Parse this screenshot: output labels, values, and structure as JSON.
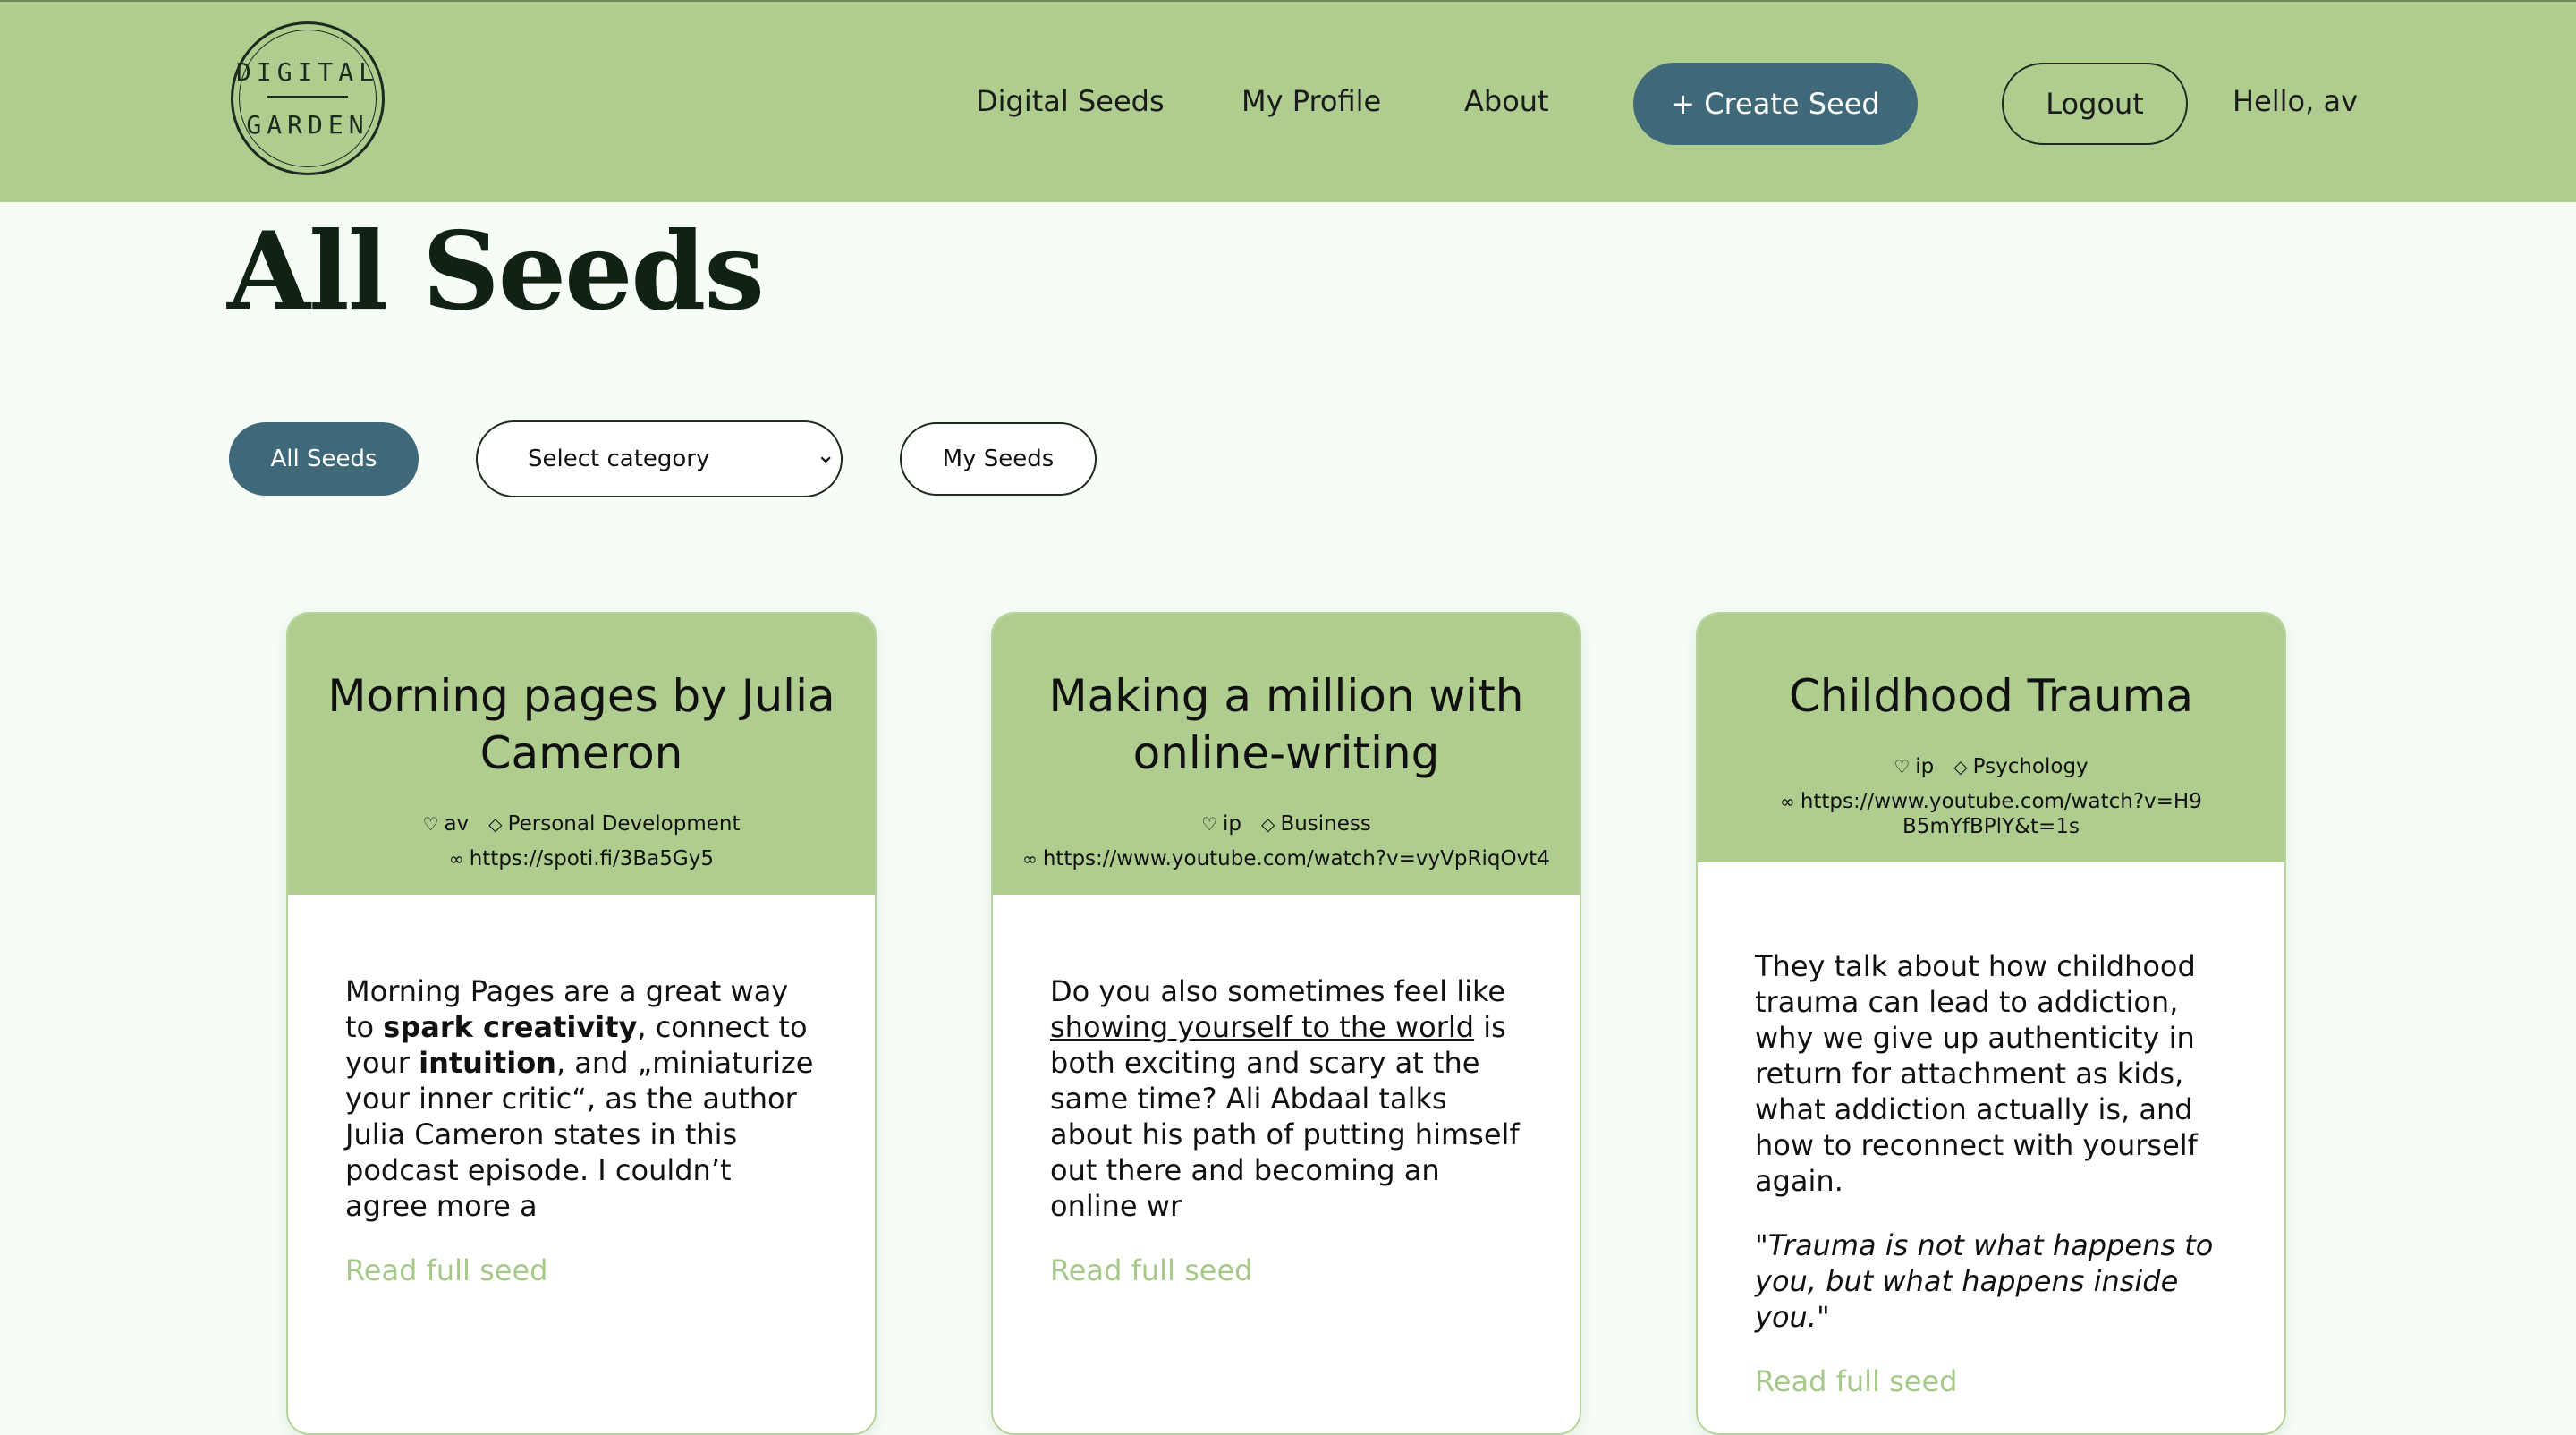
{
  "logo": {
    "line1": "DIGITAL",
    "line2": "GARDEN"
  },
  "nav": {
    "digital_seeds": "Digital Seeds",
    "my_profile": "My Profile",
    "about": "About",
    "create_seed": "+ Create Seed",
    "logout": "Logout",
    "greeting": "Hello, av"
  },
  "page_title": "All Seeds",
  "filters": {
    "all_seeds": "All Seeds",
    "category_select": "Select category",
    "my_seeds": "My Seeds"
  },
  "cards": [
    {
      "title": "Morning pages by Julia Cameron",
      "author": "av",
      "category": "Personal Development",
      "url": "https://spoti.fi/3Ba5Gy5",
      "body_parts": [
        "Morning Pages are a great way to ",
        "spark creativity",
        ", connect to your ",
        "intuition",
        ", and „miniaturize your inner critic“, as the author Julia Cameron states in this podcast episode. I couldn’t agree more a"
      ],
      "read_more": "Read full seed"
    },
    {
      "title": "Making a million with online-writing",
      "author": "ip",
      "category": "Business",
      "url": "https://www.youtube.com/watch?v=vyVpRiqOvt4",
      "body_parts": [
        "Do you also sometimes feel like ",
        "showing yourself to the world",
        " is both exciting and scary at the same time? Ali Abdaal talks about his path of putting himself out there and becoming an online wr"
      ],
      "read_more": "Read full seed"
    },
    {
      "title": "Childhood Trauma",
      "author": "ip",
      "category": "Psychology",
      "url": "https://www.youtube.com/watch?v=H9B5mYfBPlY&t=1s",
      "body_text": "They talk about how childhood trauma can lead to addiction, why we give up authenticity in return for attachment as kids, what addiction actually is, and how to reconnect with yourself again.",
      "quote": "\"Trauma is not what happens to you, but what happens inside you.\"",
      "read_more": "Read full seed"
    }
  ],
  "colors": {
    "header_bg": "#afcd8f",
    "primary_button": "#3f6879",
    "link_green": "#a6c98a",
    "page_bg": "#f6fdf7"
  },
  "icons": {
    "author": "user-icon",
    "category": "tag-icon",
    "link": "link-icon",
    "select": "chevron-down-icon"
  }
}
